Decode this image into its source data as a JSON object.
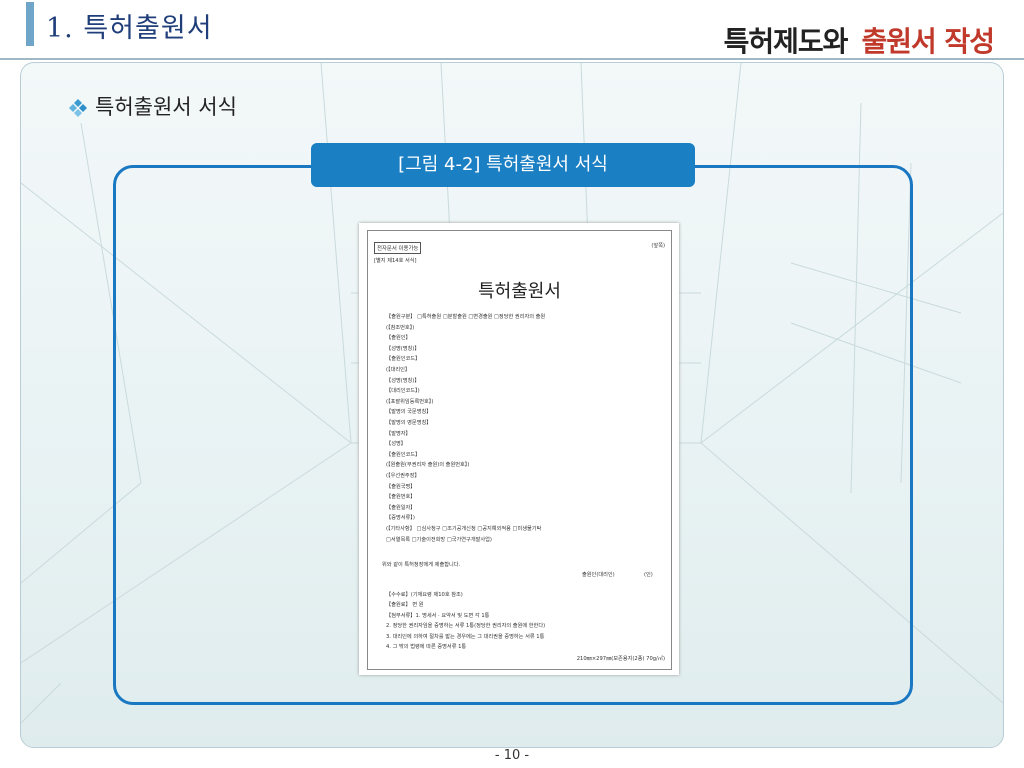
{
  "header": {
    "title": "1. 특허출원서",
    "right_title_part1": "특허제도와",
    "right_title_part2": "출원서 작성"
  },
  "section": {
    "subtitle": "특허출원서 서식"
  },
  "figure": {
    "caption": "[그림 4-2] 특허출원서 서식"
  },
  "document": {
    "badge": "전자문서 이용가능",
    "top_right": "(앞쪽)",
    "form_no": "[별지 제14호 서식]",
    "title": "특허출원서",
    "lines": [
      "【출원구분】 □특허출원 □분할출원 □변경출원 □정당한 권리자의 출원",
      "(【참조번호】)",
      "【출원인】",
      "  【성명(명칭)】",
      "  【출원인코드】",
      "(【대리인】",
      "  【성명(명칭)】",
      "  【대리인코드】)",
      "  (【포괄위임등록번호】)",
      "【발명의 국문명칭】",
      "【발명의 영문명칭】",
      "【발명자】",
      "  【성명】",
      "  【출원인코드】",
      "(【원출원(무권리자 출원)의 출원번호】)",
      "(【우선권주장】",
      "  【출원국명】",
      "  【출원번호】",
      "  【출원일자】",
      "  【증명서류】)",
      "(【기타사항】 □심사청구 □조기공개신청 □공지예외적용 □미생물기탁",
      "          □서열목록 □기술이전희망 □국가연구개발사업)"
    ],
    "declaration": "위와 같이 특허청장에게 제출합니다.",
    "applicant_sign": "출원인(대리인)",
    "seal": "(인)",
    "fee_lines": [
      "【수수료】(기재요령 제10호 참조)",
      "  【출원료】         면         원",
      "【첨부서류】1. 명세서 · 요약서 및 도면 각 1통",
      "            2. 정당한 권리자임을 증명하는 서류 1통(정당한 권리자의 출원에 한한다)",
      "            3. 대리인에 의하여 절차를 밟는 경우에는 그 대리권을 증명하는 서류 1통",
      "            4. 그 밖의 법령에 따른 증명서류 1통"
    ],
    "paper_spec": "210㎜×297㎜(보존용지(2종) 70g/㎡)"
  },
  "footer": {
    "page_number": "- 10 -"
  },
  "colors": {
    "header_bar": "#6fa5c8",
    "header_title": "#1f3e7a",
    "accent_red": "#c0392b",
    "frame_blue": "#1a78c2",
    "caption_bg": "#1b7fc4"
  }
}
